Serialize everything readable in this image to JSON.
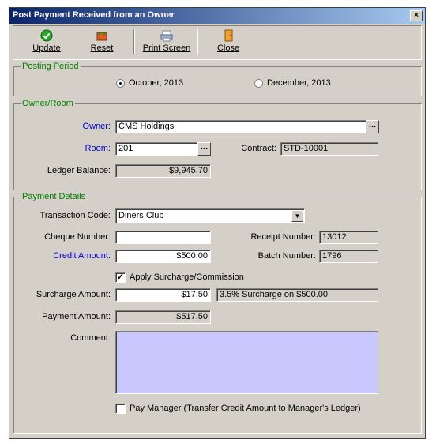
{
  "window": {
    "title": "Post Payment Received from an Owner",
    "close_glyph": "×"
  },
  "toolbar": {
    "update": "Update",
    "reset": "Reset",
    "print": "Print Screen",
    "close": "Close"
  },
  "posting_period": {
    "legend": "Posting Period",
    "options": [
      {
        "label": "October, 2013",
        "selected": true
      },
      {
        "label": "December, 2013",
        "selected": false
      }
    ]
  },
  "owner_room": {
    "legend": "Owner/Room",
    "owner_label": "Owner:",
    "owner_value": "CMS Holdings",
    "room_label": "Room:",
    "room_value": "201",
    "contract_label": "Contract:",
    "contract_value": "STD-10001",
    "ledger_label": "Ledger Balance:",
    "ledger_value": "$9,945.70",
    "ellipsis": "..."
  },
  "payment": {
    "legend": "Payment Details",
    "txn_code_label": "Transaction Code:",
    "txn_code_value": "Diners Club",
    "cheque_label": "Cheque Number:",
    "cheque_value": "",
    "receipt_label": "Receipt Number:",
    "receipt_value": "13012",
    "credit_label": "Credit Amount:",
    "credit_value": "$500.00",
    "batch_label": "Batch Number:",
    "batch_value": "1796",
    "surcharge_check_label": "Apply Surcharge/Commission",
    "surcharge_checked": true,
    "surcharge_label": "Surcharge Amount:",
    "surcharge_value": "$17.50",
    "surcharge_desc": "3.5% Surcharge on $500.00",
    "payment_amount_label": "Payment Amount:",
    "payment_amount_value": "$517.50",
    "comment_label": "Comment:",
    "comment_value": "",
    "pay_manager_label": "Pay Manager  (Transfer Credit Amount to Manager's Ledger)",
    "pay_manager_checked": false
  },
  "colors": {
    "legend": "#008000",
    "accent_label": "#0000cc",
    "comment_bg": "#c8c8ff",
    "titlebar": "#0a246a"
  }
}
